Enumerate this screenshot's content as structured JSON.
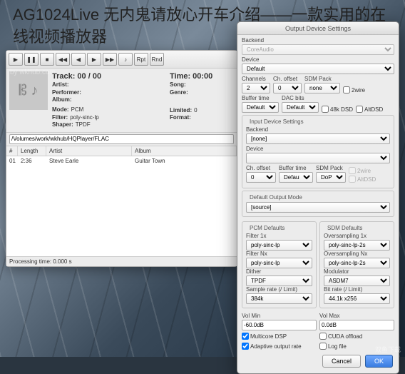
{
  "headline": "AG1024Live 无内鬼请放心开车介绍——一款实用的在线视频播放器",
  "watermark": "by wkhub.com",
  "toolbar": {
    "play": "▶",
    "pause": "❚❚",
    "stop": "■",
    "prev": "◀◀",
    "next": "▶▶",
    "rew": "◀",
    "fwd": "▶",
    "vol": "♪",
    "rpt": "Rpt",
    "rnd": "Rnd"
  },
  "player": {
    "cover_glyph": "𝄡 ♪",
    "track_label": "Track:",
    "track_value": "00 / 00",
    "artist_label": "Artist:",
    "artist_value": "",
    "performer_label": "Performer:",
    "performer_value": "",
    "album_label": "Album:",
    "album_value": "",
    "mode_label": "Mode:",
    "mode_value": "PCM",
    "filter_label": "Filter:",
    "filter_value": "poly-sinc-lp",
    "shaper_label": "Shaper:",
    "shaper_value": "TPDF",
    "time_label": "Time:",
    "time_value": "00:00",
    "song_label": "Song:",
    "song_value": "",
    "genre_label": "Genre:",
    "genre_value": "",
    "limited_label": "Limited:",
    "limited_value": "0",
    "format_label": "Format:",
    "format_value": ""
  },
  "path": "/Volumes/work/wkhub/HQPlayer/FLAC",
  "table": {
    "cols": {
      "num": "#",
      "length": "Length",
      "artist": "Artist",
      "album": "Album"
    },
    "rows": [
      {
        "num": "01",
        "length": "2:36",
        "artist": "Steve Earle",
        "album": "Guitar Town"
      }
    ]
  },
  "status": "Processing time: 0.000 s",
  "settings": {
    "title": "Output Device Settings",
    "output": {
      "legend": "",
      "backend_label": "Backend",
      "backend": "CoreAudio",
      "device_label": "Device",
      "device": "Default",
      "channels_label": "Channels",
      "channels": "2",
      "choffset_label": "Ch. offset",
      "choffset": "0",
      "sdmpack_label": "SDM Pack",
      "sdmpack": "none",
      "twowire": "2wire",
      "buffer_label": "Buffer time",
      "buffer": "Default",
      "dac_label": "DAC bits",
      "dac": "Default",
      "dsd48": "48k DSD",
      "altdsd": "AltDSD"
    },
    "input": {
      "legend": "Input Device Settings",
      "backend_label": "Backend",
      "backend": "[none]",
      "device_label": "Device",
      "device": "",
      "choffset_label": "Ch. offset",
      "choffset": "0",
      "buffer_label": "Buffer time",
      "buffer": "Default",
      "sdmpack_label": "SDM Pack",
      "sdmpack": "DoP",
      "twowire": "2wire",
      "altdsd": "AltDSD"
    },
    "defmode": {
      "legend": "Default Output Mode",
      "value": "[source]"
    },
    "pcm": {
      "legend": "PCM Defaults",
      "f1x_label": "Filter 1x",
      "f1x": "poly-sinc-lp",
      "fnx_label": "Filter Nx",
      "fnx": "poly-sinc-lp",
      "dither_label": "Dither",
      "dither": "TPDF",
      "rate_label": "Sample rate (/ Limit)",
      "rate": "384k"
    },
    "sdm": {
      "legend": "SDM Defaults",
      "o1x_label": "Oversampling 1x",
      "o1x": "poly-sinc-lp-2s",
      "onx_label": "Oversampling Nx",
      "onx": "poly-sinc-lp-2s",
      "mod_label": "Modulator",
      "mod": "ASDM7",
      "rate_label": "Bit rate (/ Limit)",
      "rate": "44.1k x256"
    },
    "vol": {
      "min_label": "Vol Min",
      "min": "-60.0dB",
      "max_label": "Vol Max",
      "max": "0.0dB"
    },
    "flags": {
      "multicore": "Multicore DSP",
      "cuda": "CUDA offload",
      "adaptive": "Adaptive output rate",
      "log": "Log file"
    },
    "cancel": "Cancel",
    "ok": "OK"
  },
  "corner": "双鱼下载"
}
